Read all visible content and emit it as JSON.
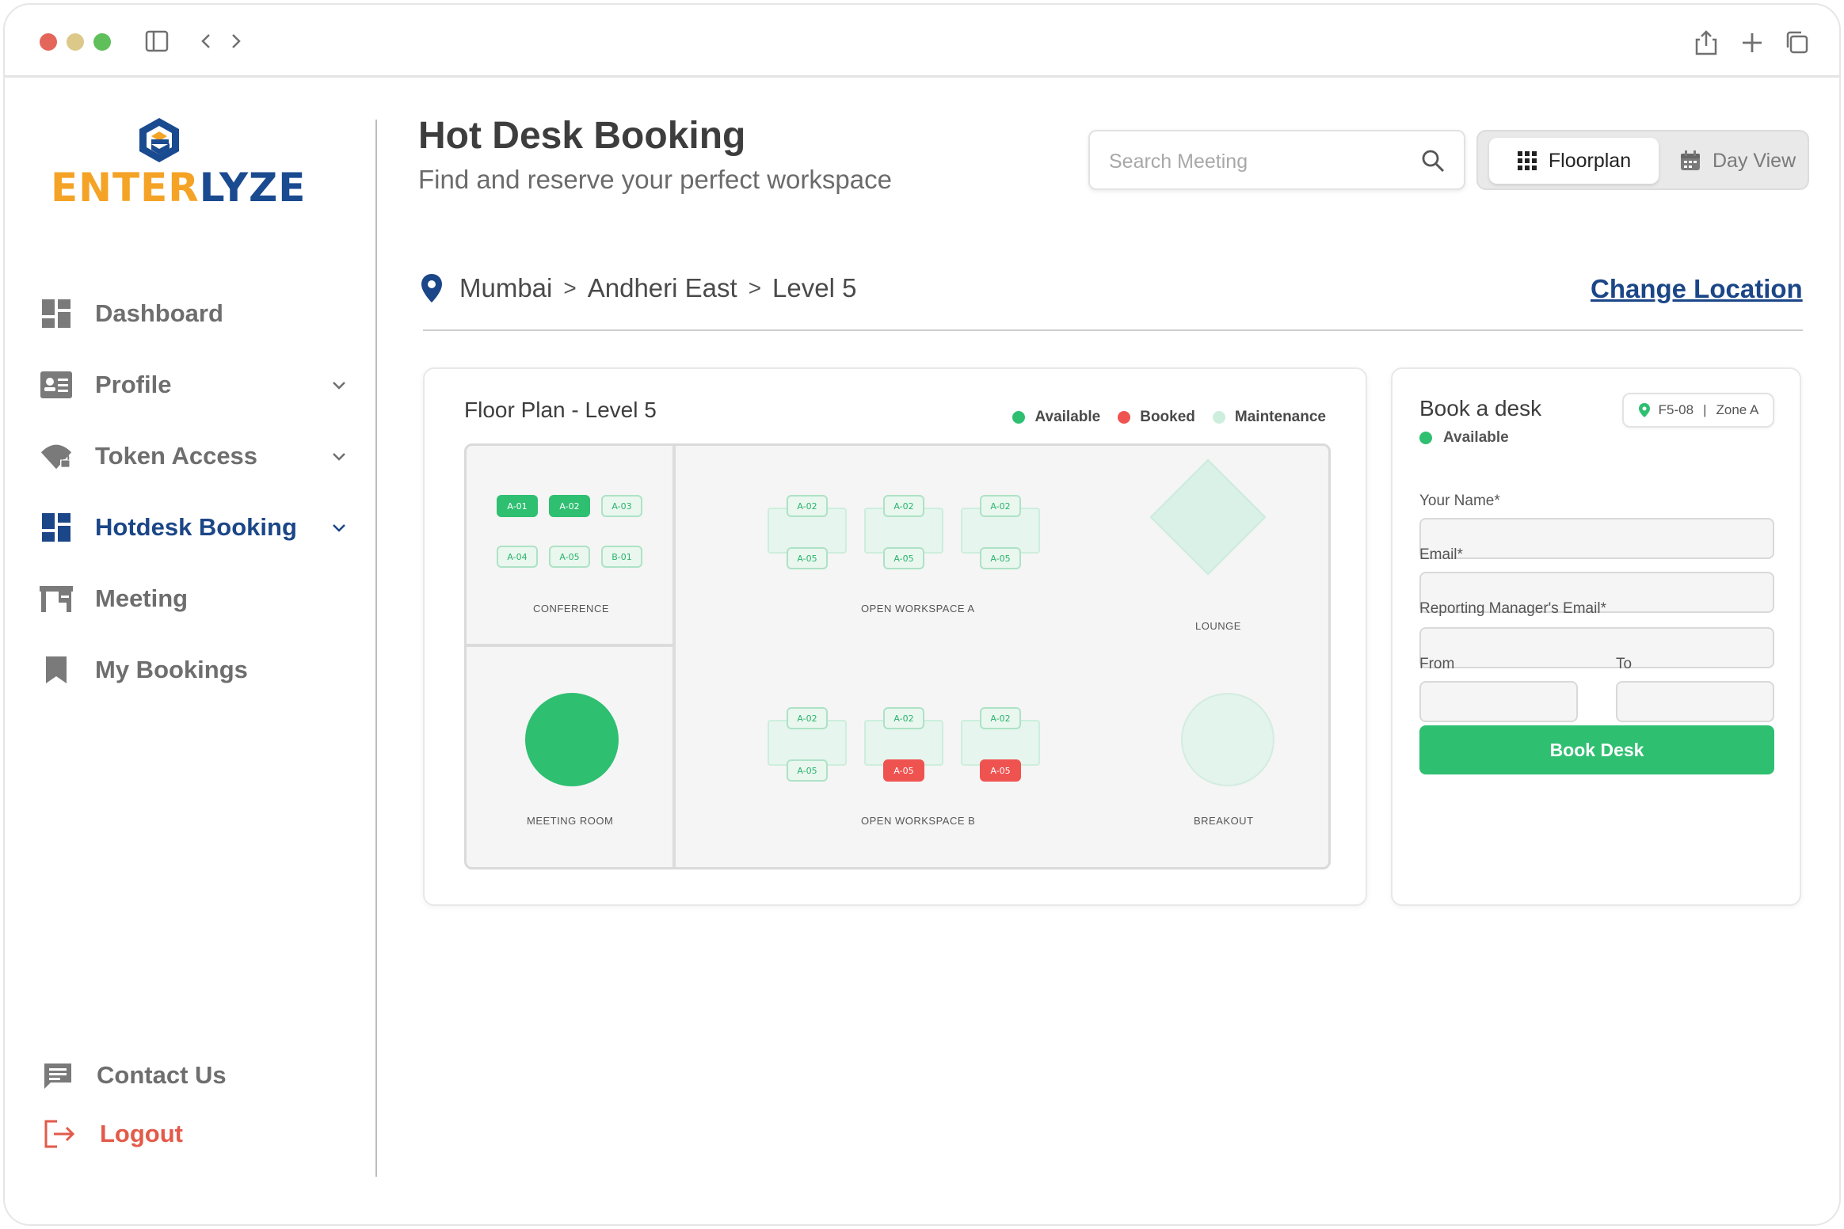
{
  "brand": {
    "logo_text_1": "ENTER",
    "logo_text_2": "LYZE",
    "orange": "#f4a326",
    "blue": "#1a4a8f"
  },
  "sidebar": {
    "items": [
      {
        "label": "Dashboard",
        "icon": "dashboard-icon"
      },
      {
        "label": "Profile",
        "icon": "profile-card-icon"
      },
      {
        "label": "Token Access",
        "icon": "wifi-lock-icon"
      },
      {
        "label": "Hotdesk Booking",
        "icon": "grid-icon",
        "active": true
      },
      {
        "label": "Meeting",
        "icon": "desk-icon"
      },
      {
        "label": "My Bookings",
        "icon": "bookmark-icon"
      }
    ],
    "footer": {
      "contact": "Contact Us",
      "logout": "Logout"
    }
  },
  "header": {
    "title": "Hot Desk Booking",
    "subtitle": "Find and reserve your perfect workspace",
    "search_placeholder": "Search Meeting",
    "view_floorplan": "Floorplan",
    "view_day": "Day View"
  },
  "breadcrumb": {
    "city": "Mumbai",
    "area": "Andheri East",
    "level": "Level 5",
    "separator": ">",
    "change": "Change Location"
  },
  "floorplan": {
    "title": "Floor Plan - Level 5",
    "legend": {
      "available": "Available",
      "booked": "Booked",
      "maintenance": "Maintenance"
    },
    "colors": {
      "available": "#2fbf71",
      "booked": "#ef5350",
      "maintenance": "#cdeedd"
    },
    "zones": {
      "conference": "CONFERENCE",
      "meeting_room": "MEETING ROOM",
      "open_a": "OPEN WORKSPACE A",
      "open_b": "OPEN WORKSPACE B",
      "lounge": "LOUNGE",
      "breakout": "BREAKOUT"
    },
    "conference_desks": [
      {
        "id": "A-01",
        "status": "available"
      },
      {
        "id": "A-02",
        "status": "available"
      },
      {
        "id": "A-03",
        "status": "maintenance"
      },
      {
        "id": "A-04",
        "status": "maintenance"
      },
      {
        "id": "A-05",
        "status": "maintenance"
      },
      {
        "id": "B-01",
        "status": "maintenance"
      }
    ],
    "open_a_desks": [
      {
        "top": "A-02",
        "bottom": "A-05",
        "bottom_status": "maintenance"
      },
      {
        "top": "A-02",
        "bottom": "A-05",
        "bottom_status": "maintenance"
      },
      {
        "top": "A-02",
        "bottom": "A-05",
        "bottom_status": "maintenance"
      }
    ],
    "open_b_desks": [
      {
        "top": "A-02",
        "bottom": "A-05",
        "bottom_status": "maintenance"
      },
      {
        "top": "A-02",
        "bottom": "A-05",
        "bottom_status": "booked"
      },
      {
        "top": "A-02",
        "bottom": "A-05",
        "bottom_status": "booked"
      }
    ]
  },
  "booking": {
    "title": "Book a desk",
    "status": "Available",
    "desk_id": "F5-08",
    "zone": "Zone A",
    "chip_sep": "|",
    "name_label": "Your Name*",
    "email_label": "Email*",
    "manager_label": "Reporting Manager's Email*",
    "from_label": "From",
    "to_label": "To",
    "button": "Book Desk"
  }
}
